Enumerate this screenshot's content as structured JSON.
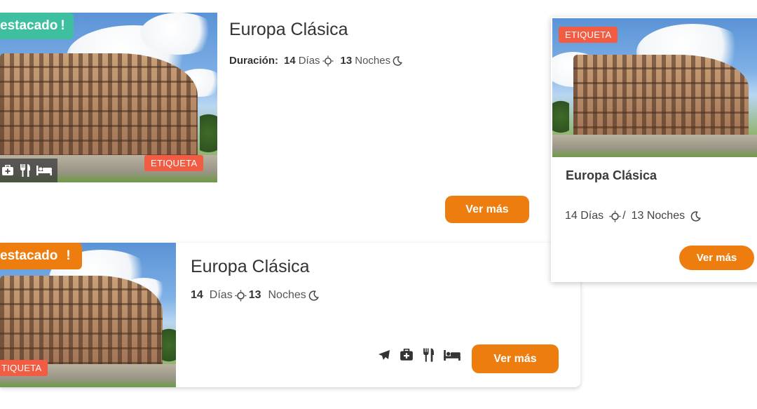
{
  "card1": {
    "featured_label": "estacado",
    "featured_mark": "!",
    "tag": "ETIQUETA",
    "title": "Europa Clásica",
    "duration_label": "Duración:",
    "days_num": "14",
    "days_label": "Días",
    "nights_num": "13",
    "nights_label": "Noches",
    "button": "Ver más",
    "amenity_icons": [
      "medkit-icon",
      "utensils-icon",
      "bed-icon"
    ],
    "badge_color": "#3ec0a0"
  },
  "card2": {
    "featured_label": "estacado",
    "featured_mark": "!",
    "tag": "TIQUETA",
    "title": "Europa Clásica",
    "days_num": "14",
    "days_label": "Días",
    "nights_num": "13",
    "nights_label": "Noches",
    "button": "Ver más",
    "amenity_icons": [
      "plane-icon",
      "medkit-icon",
      "utensils-icon",
      "bed-icon"
    ],
    "badge_color": "#ee7d10"
  },
  "card3": {
    "tag": "ETIQUETA",
    "title": "Europa Clásica",
    "days": "14 Días",
    "separator": "/",
    "nights": "13 Noches",
    "button": "Ver más"
  },
  "colors": {
    "orange": "#ee7d10",
    "teal": "#3ec0a0",
    "tag_red": "#f25c43"
  }
}
